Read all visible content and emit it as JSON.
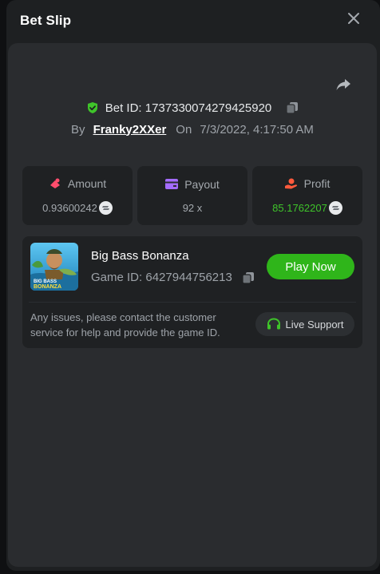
{
  "header": {
    "title": "Bet Slip"
  },
  "bet": {
    "id_label": "Bet ID:",
    "id_value": "1737330074279425920",
    "by_label": "By",
    "user": "Franky2XXer",
    "on_label": "On",
    "date": "7/3/2022, 4:17:50 AM"
  },
  "stats": {
    "amount": {
      "label": "Amount",
      "value": "0.93600242"
    },
    "payout": {
      "label": "Payout",
      "value": "92 x"
    },
    "profit": {
      "label": "Profit",
      "value": "85.1762207"
    }
  },
  "game": {
    "name": "Big Bass Bonanza",
    "id_label": "Game ID:",
    "id_value": "6427944756213",
    "play_label": "Play Now",
    "thumb_text_top": "BIG BASS",
    "thumb_text_bottom": "BONANZA"
  },
  "support": {
    "notice": "Any issues, please contact the customer service for help and provide the game ID.",
    "button_label": "Live Support"
  },
  "colors": {
    "accent_green": "#2fb51a",
    "profit_green": "#3fc42a",
    "amount_icon": "#ff4d6d",
    "payout_icon": "#a46cff",
    "profit_icon": "#ff5a3c",
    "shield_green": "#3fc42a"
  },
  "icons": [
    "close-icon",
    "share-icon",
    "shield-check-icon",
    "copy-icon",
    "amount-icon",
    "wallet-icon",
    "profit-icon",
    "coin-icon",
    "headset-icon"
  ]
}
